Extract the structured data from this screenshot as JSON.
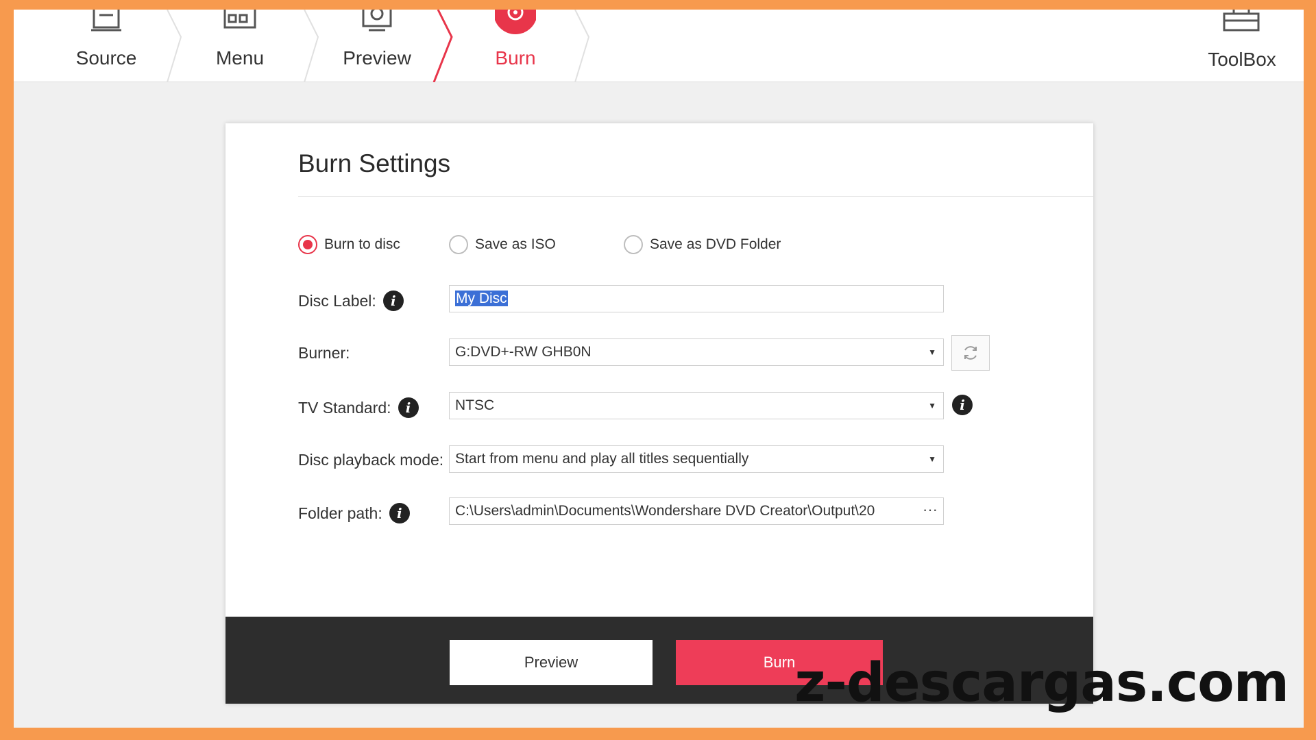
{
  "steps": [
    {
      "label": "Source",
      "icon": "source-icon"
    },
    {
      "label": "Menu",
      "icon": "menu-icon"
    },
    {
      "label": "Preview",
      "icon": "preview-icon"
    },
    {
      "label": "Burn",
      "icon": "burn-disc-icon",
      "active": true
    }
  ],
  "toolbox": {
    "label": "ToolBox",
    "icon": "toolbox-icon"
  },
  "dialog": {
    "title": "Burn Settings",
    "radios": [
      {
        "label": "Burn to disc",
        "checked": true
      },
      {
        "label": "Save as ISO",
        "checked": false
      },
      {
        "label": "Save as DVD Folder",
        "checked": false
      }
    ],
    "disc_label": {
      "label": "Disc Label:",
      "value": "My Disc"
    },
    "burner": {
      "label": "Burner:",
      "value": "G:DVD+-RW GHB0N"
    },
    "tv_standard": {
      "label": "TV Standard:",
      "value": "NTSC"
    },
    "playback_mode": {
      "label": "Disc playback mode:",
      "value": "Start from menu and play all titles sequentially"
    },
    "folder_path": {
      "label": "Folder path:",
      "value": "C:\\Users\\admin\\Documents\\Wondershare DVD Creator\\Output\\20",
      "more": "···"
    },
    "info_glyph": "i",
    "caret_glyph": "▼"
  },
  "footer": {
    "preview_label": "Preview",
    "burn_label": "Burn"
  },
  "watermark": "z-descargas.com",
  "colors": {
    "accent": "#e8354a",
    "frame": "#f79a4e",
    "footer_bg": "#2d2d2d"
  }
}
